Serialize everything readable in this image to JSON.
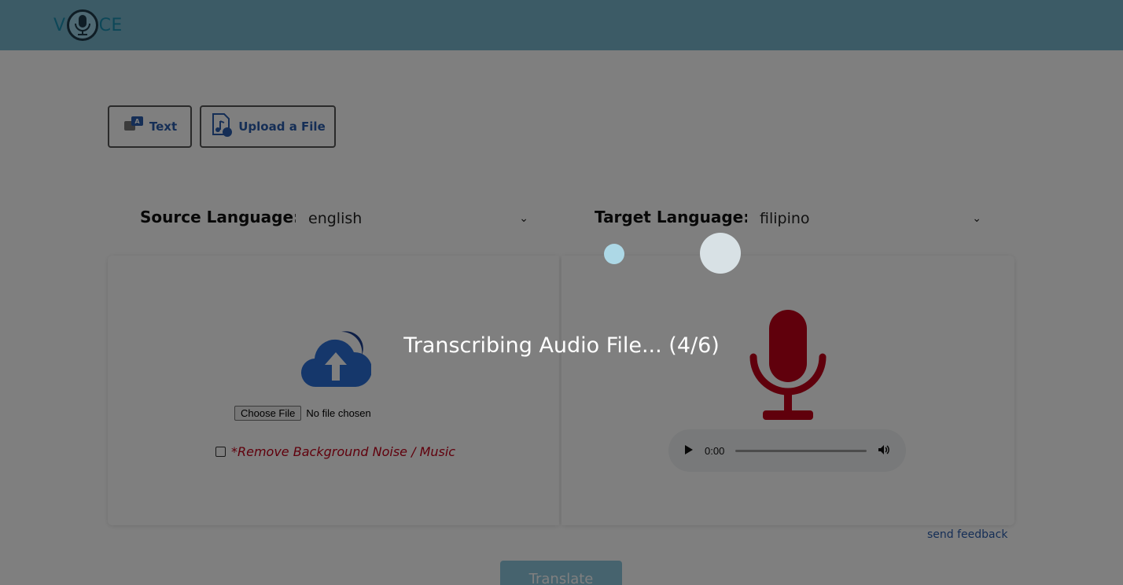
{
  "header": {
    "logo_text_left": "V",
    "logo_text_right": "CE",
    "logo_icon": "microphone-logo-icon"
  },
  "modes": {
    "text_label": "Text",
    "text_icon": "chat-translate-icon",
    "upload_label": "Upload a File",
    "upload_icon": "music-file-icon"
  },
  "languages": {
    "source_label": "Source Language:",
    "source_value": "english",
    "target_label": "Target Language:",
    "target_value": "filipino"
  },
  "upload_panel": {
    "cloud_icon": "cloud-upload-icon",
    "choose_file_label": "Choose File",
    "no_file_text": "No file chosen",
    "noise_label": "*Remove Background Noise / Music",
    "noise_checked": false
  },
  "output_panel": {
    "mic_icon": "microphone-icon",
    "audio_time": "0:00",
    "play_icon": "play-icon",
    "volume_icon": "volume-icon"
  },
  "footer": {
    "feedback_link": "send feedback",
    "translate_label": "Translate"
  },
  "overlay": {
    "status_text": "Transcribing Audio File... (4/6)"
  },
  "colors": {
    "header_bg": "#78b6cd",
    "accent_blue": "#2a5dac",
    "mic_red": "#c00018",
    "noise_red": "#c00018"
  }
}
